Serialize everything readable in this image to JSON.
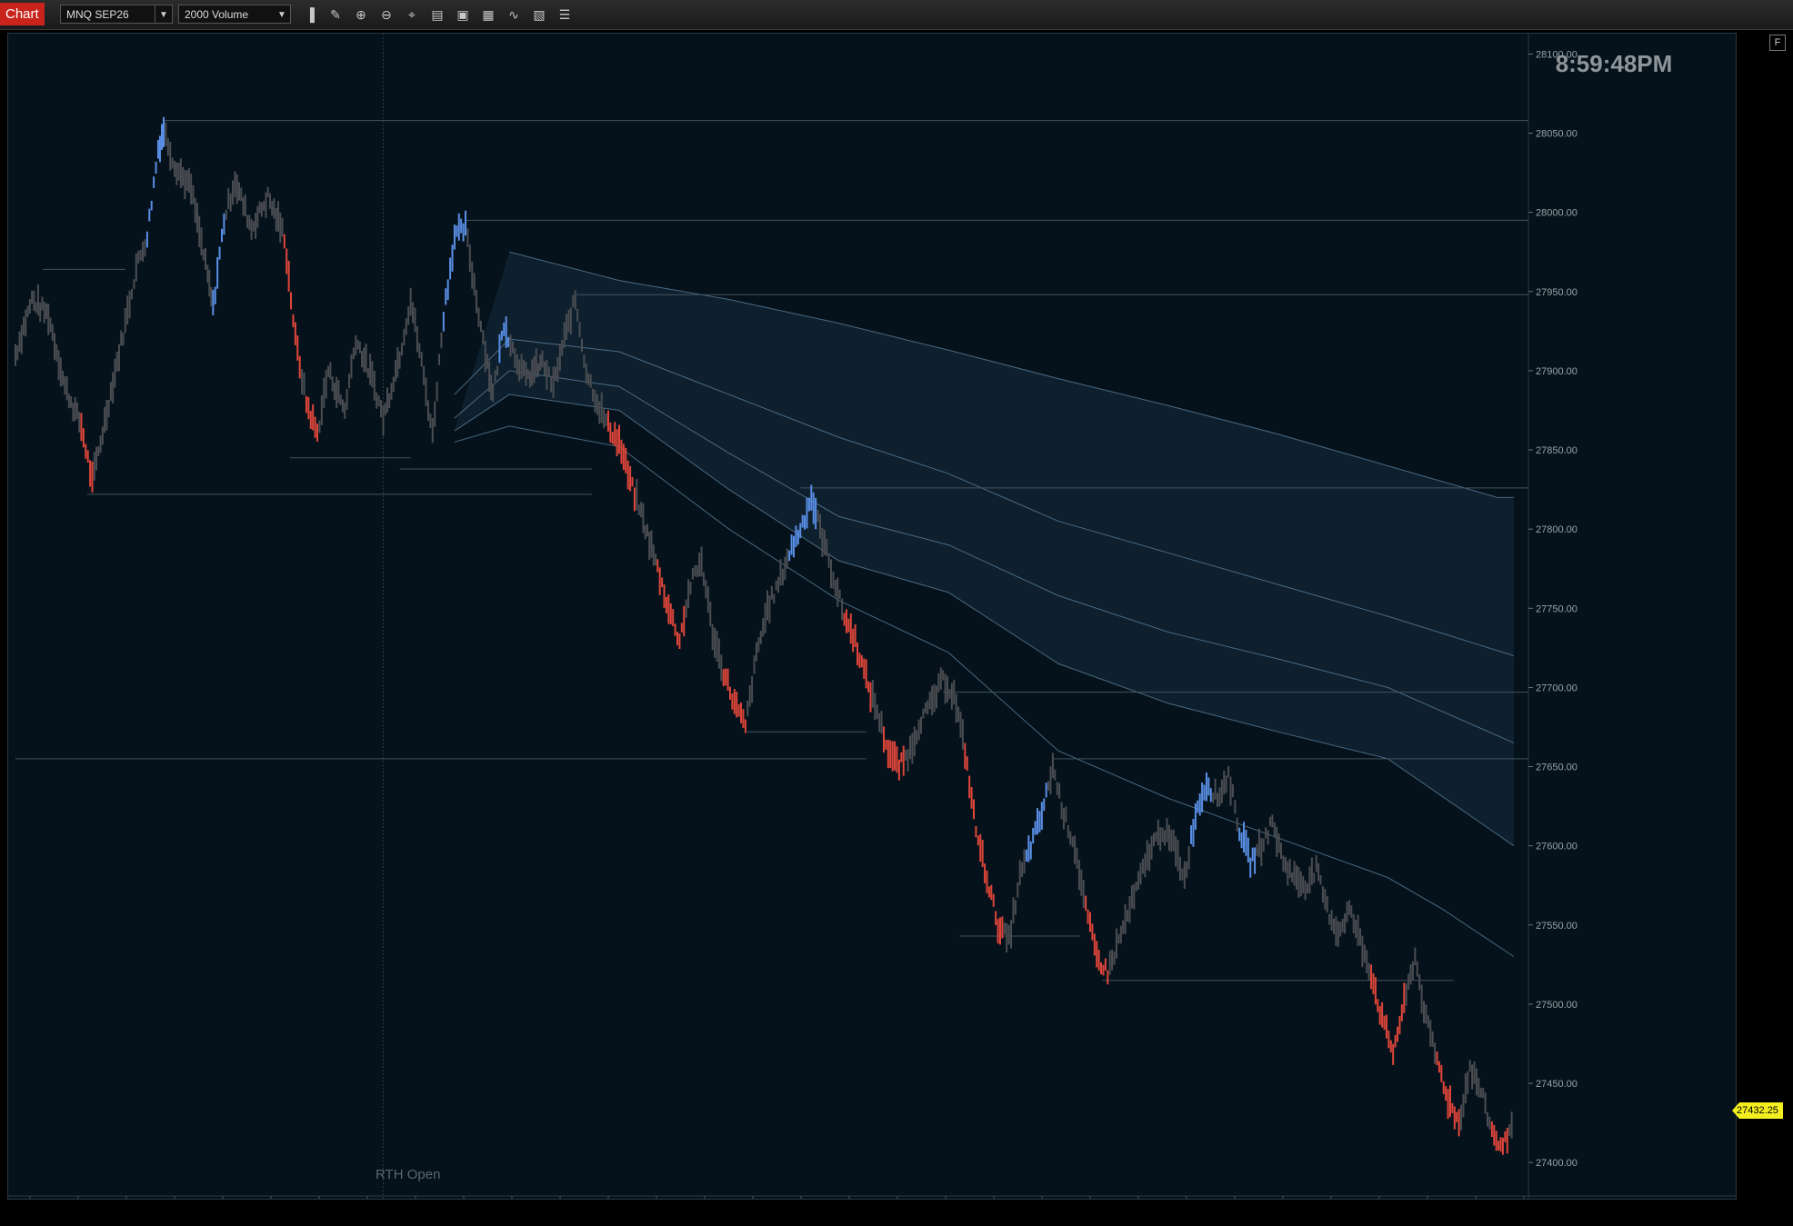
{
  "toolbar": {
    "chart_tab": "Chart",
    "instrument": "MNQ SEP26",
    "interval": "2000 Volume",
    "icons": [
      "bar-style-icon",
      "draw-tools-icon",
      "zoom-in-icon",
      "zoom-out-icon",
      "crosshair-icon",
      "data-box-icon",
      "chart-trader-icon",
      "strategies-icon",
      "indicators-icon",
      "properties-icon",
      "list-icon"
    ]
  },
  "clock": "8:59:48PM",
  "session_label": "RTH Open",
  "last_price": "27432.25",
  "corner_button": "F",
  "colors": {
    "background": "#05121b",
    "neutral_bar": "#4a4d52",
    "up_bar": "#5a8fe6",
    "down_bar": "#e0463a",
    "level_line": "#44535e",
    "band": "#5a7d99"
  },
  "chart_data": {
    "type": "line",
    "ylim": [
      27380,
      28110
    ],
    "y_ticks": [
      "28100.00",
      "28050.00",
      "28000.00",
      "27950.00",
      "27900.00",
      "27850.00",
      "27800.00",
      "27750.00",
      "27700.00",
      "27650.00",
      "27600.00",
      "27550.00",
      "27500.00",
      "27450.00",
      "27400.00"
    ],
    "price_path": [
      [
        0,
        27910
      ],
      [
        3,
        27945
      ],
      [
        6,
        27935
      ],
      [
        9,
        27890
      ],
      [
        12,
        27865
      ],
      [
        14,
        27830
      ],
      [
        17,
        27880
      ],
      [
        20,
        27930
      ],
      [
        22,
        27965
      ],
      [
        24,
        27985
      ],
      [
        26,
        28040
      ],
      [
        27,
        28052
      ],
      [
        29,
        28030
      ],
      [
        32,
        28015
      ],
      [
        35,
        27960
      ],
      [
        36,
        27940
      ],
      [
        38,
        27995
      ],
      [
        40,
        28020
      ],
      [
        43,
        27990
      ],
      [
        46,
        28010
      ],
      [
        49,
        27985
      ],
      [
        51,
        27920
      ],
      [
        53,
        27880
      ],
      [
        55,
        27860
      ],
      [
        57,
        27900
      ],
      [
        60,
        27875
      ],
      [
        62,
        27920
      ],
      [
        65,
        27895
      ],
      [
        67,
        27870
      ],
      [
        70,
        27910
      ],
      [
        72,
        27945
      ],
      [
        74,
        27905
      ],
      [
        76,
        27860
      ],
      [
        78,
        27935
      ],
      [
        80,
        27985
      ],
      [
        82,
        27990
      ],
      [
        84,
        27945
      ],
      [
        86,
        27905
      ],
      [
        87,
        27885
      ],
      [
        89,
        27930
      ],
      [
        91,
        27910
      ],
      [
        93,
        27895
      ],
      [
        96,
        27905
      ],
      [
        98,
        27890
      ],
      [
        100,
        27920
      ],
      [
        102,
        27945
      ],
      [
        104,
        27900
      ],
      [
        106,
        27880
      ],
      [
        108,
        27865
      ],
      [
        110,
        27855
      ],
      [
        112,
        27830
      ],
      [
        114,
        27810
      ],
      [
        117,
        27775
      ],
      [
        119,
        27750
      ],
      [
        121,
        27730
      ],
      [
        123,
        27765
      ],
      [
        125,
        27780
      ],
      [
        127,
        27735
      ],
      [
        129,
        27710
      ],
      [
        131,
        27690
      ],
      [
        133,
        27675
      ],
      [
        135,
        27720
      ],
      [
        137,
        27750
      ],
      [
        139,
        27765
      ],
      [
        141,
        27785
      ],
      [
        143,
        27800
      ],
      [
        145,
        27820
      ],
      [
        147,
        27795
      ],
      [
        149,
        27770
      ],
      [
        151,
        27745
      ],
      [
        153,
        27730
      ],
      [
        155,
        27705
      ],
      [
        157,
        27685
      ],
      [
        159,
        27660
      ],
      [
        161,
        27650
      ],
      [
        163,
        27660
      ],
      [
        165,
        27680
      ],
      [
        167,
        27690
      ],
      [
        169,
        27705
      ],
      [
        171,
        27695
      ],
      [
        173,
        27660
      ],
      [
        175,
        27610
      ],
      [
        177,
        27580
      ],
      [
        179,
        27550
      ],
      [
        181,
        27540
      ],
      [
        183,
        27580
      ],
      [
        185,
        27600
      ],
      [
        187,
        27620
      ],
      [
        189,
        27650
      ],
      [
        191,
        27620
      ],
      [
        193,
        27600
      ],
      [
        195,
        27560
      ],
      [
        197,
        27530
      ],
      [
        199,
        27520
      ],
      [
        201,
        27540
      ],
      [
        203,
        27560
      ],
      [
        205,
        27580
      ],
      [
        207,
        27600
      ],
      [
        209,
        27610
      ],
      [
        211,
        27600
      ],
      [
        213,
        27580
      ],
      [
        215,
        27620
      ],
      [
        217,
        27640
      ],
      [
        219,
        27630
      ],
      [
        221,
        27645
      ],
      [
        223,
        27610
      ],
      [
        225,
        27590
      ],
      [
        227,
        27600
      ],
      [
        229,
        27615
      ],
      [
        231,
        27590
      ],
      [
        233,
        27580
      ],
      [
        235,
        27575
      ],
      [
        237,
        27585
      ],
      [
        239,
        27560
      ],
      [
        241,
        27545
      ],
      [
        243,
        27560
      ],
      [
        245,
        27540
      ],
      [
        247,
        27520
      ],
      [
        249,
        27490
      ],
      [
        251,
        27470
      ],
      [
        253,
        27500
      ],
      [
        255,
        27530
      ],
      [
        257,
        27490
      ],
      [
        259,
        27465
      ],
      [
        261,
        27440
      ],
      [
        263,
        27425
      ],
      [
        265,
        27460
      ],
      [
        267,
        27445
      ],
      [
        269,
        27420
      ],
      [
        271,
        27408
      ],
      [
        273,
        27432
      ]
    ],
    "up_segments": [
      [
        24,
        27
      ],
      [
        36,
        38
      ],
      [
        78,
        82
      ],
      [
        88,
        90
      ],
      [
        141,
        146
      ],
      [
        184,
        188
      ],
      [
        214,
        218
      ],
      [
        223,
        226
      ]
    ],
    "down_segments": [
      [
        12,
        14
      ],
      [
        49,
        52
      ],
      [
        53,
        55
      ],
      [
        108,
        113
      ],
      [
        117,
        122
      ],
      [
        129,
        133
      ],
      [
        151,
        156
      ],
      [
        158,
        162
      ],
      [
        173,
        180
      ],
      [
        195,
        199
      ],
      [
        247,
        253
      ],
      [
        259,
        263
      ],
      [
        269,
        272
      ]
    ],
    "bands": [
      {
        "name": "b1",
        "points": [
          [
            90,
            27975
          ],
          [
            110,
            27957
          ],
          [
            130,
            27945
          ],
          [
            150,
            27930
          ],
          [
            170,
            27913
          ],
          [
            190,
            27895
          ],
          [
            210,
            27878
          ],
          [
            230,
            27860
          ],
          [
            250,
            27840
          ],
          [
            270,
            27820
          ],
          [
            273,
            27820
          ]
        ]
      },
      {
        "name": "b2",
        "points": [
          [
            80,
            27885
          ],
          [
            90,
            27920
          ],
          [
            110,
            27912
          ],
          [
            130,
            27885
          ],
          [
            150,
            27858
          ],
          [
            170,
            27835
          ],
          [
            190,
            27805
          ],
          [
            210,
            27785
          ],
          [
            230,
            27765
          ],
          [
            250,
            27745
          ],
          [
            273,
            27720
          ]
        ]
      },
      {
        "name": "b3",
        "points": [
          [
            80,
            27870
          ],
          [
            90,
            27900
          ],
          [
            110,
            27890
          ],
          [
            130,
            27848
          ],
          [
            150,
            27808
          ],
          [
            170,
            27790
          ],
          [
            190,
            27758
          ],
          [
            210,
            27735
          ],
          [
            230,
            27718
          ],
          [
            250,
            27700
          ],
          [
            273,
            27665
          ]
        ]
      },
      {
        "name": "b4",
        "points": [
          [
            80,
            27862
          ],
          [
            90,
            27885
          ],
          [
            110,
            27875
          ],
          [
            130,
            27825
          ],
          [
            150,
            27780
          ],
          [
            170,
            27760
          ],
          [
            190,
            27715
          ],
          [
            210,
            27690
          ],
          [
            230,
            27672
          ],
          [
            250,
            27655
          ],
          [
            273,
            27600
          ]
        ]
      },
      {
        "name": "b5",
        "points": [
          [
            80,
            27855
          ],
          [
            90,
            27865
          ],
          [
            110,
            27852
          ],
          [
            130,
            27800
          ],
          [
            150,
            27755
          ],
          [
            170,
            27722
          ],
          [
            190,
            27660
          ],
          [
            210,
            27630
          ],
          [
            230,
            27605
          ],
          [
            250,
            27580
          ],
          [
            260,
            27560
          ],
          [
            273,
            27530
          ]
        ]
      }
    ],
    "levels": [
      {
        "price": 28058,
        "from": 27
      },
      {
        "price": 27995,
        "from": 82
      },
      {
        "price": 27948,
        "from": 102
      },
      {
        "price": 27826,
        "from": 143
      },
      {
        "price": 27697,
        "from": 169
      },
      {
        "price": 27655,
        "from": 189
      },
      {
        "price": 27655,
        "from": 0,
        "to": 155
      },
      {
        "price": 27964,
        "from": 5,
        "to": 20
      },
      {
        "price": 27822,
        "from": 13,
        "to": 105
      },
      {
        "price": 27845,
        "from": 50,
        "to": 72
      },
      {
        "price": 27838,
        "from": 70,
        "to": 105
      },
      {
        "price": 27672,
        "from": 133,
        "to": 155
      },
      {
        "price": 27543,
        "from": 172,
        "to": 194
      },
      {
        "price": 27515,
        "from": 198,
        "to": 262
      }
    ],
    "rth_open_x": 67,
    "x_count": 273
  }
}
